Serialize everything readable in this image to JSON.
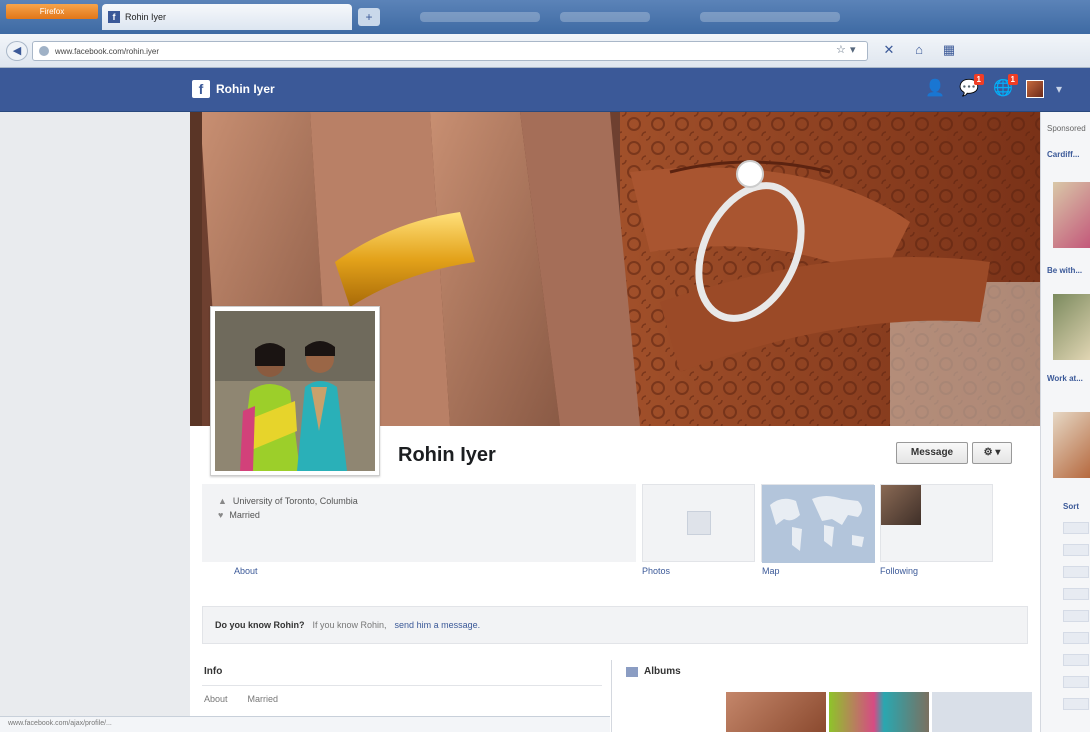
{
  "browser": {
    "firefox_button_label": "Firefox",
    "tab_title": "Rohin Iyer",
    "new_tab_label": "+",
    "url": "www.facebook.com/rohin.iyer",
    "status_text": "www.facebook.com/ajax/profile/..."
  },
  "fb": {
    "logo": "f",
    "header_username": "Rohin Iyer",
    "notifications": {
      "friend_requests": "",
      "messages": "1",
      "notifications": "1"
    },
    "more_label": "▾"
  },
  "profile": {
    "name": "Rohin Iyer",
    "message_button": "Message",
    "gear_button": "⚙ ▾",
    "info": [
      {
        "icon": "school-icon",
        "text": "University of Toronto, Columbia"
      },
      {
        "icon": "heart-icon",
        "text": "Married"
      }
    ],
    "about_link": "About",
    "thumb_labels": [
      "Photos",
      "Map",
      "Following"
    ],
    "know_question": "Do you know Rohin?",
    "know_hint": "If you know Rohin,",
    "know_link": "send him a message.",
    "info_section_title": "Info",
    "info_row_label": "About",
    "info_row_value": "Married",
    "albums_title": "Albums"
  },
  "right_rail": {
    "title": "Sponsored",
    "links": [
      "Cardiff...",
      "Be with...",
      "Work at..."
    ],
    "list_header": "Sort"
  },
  "colors": {
    "fb_blue": "#3b5998",
    "link": "#3b5998",
    "badge": "#f03d25"
  }
}
